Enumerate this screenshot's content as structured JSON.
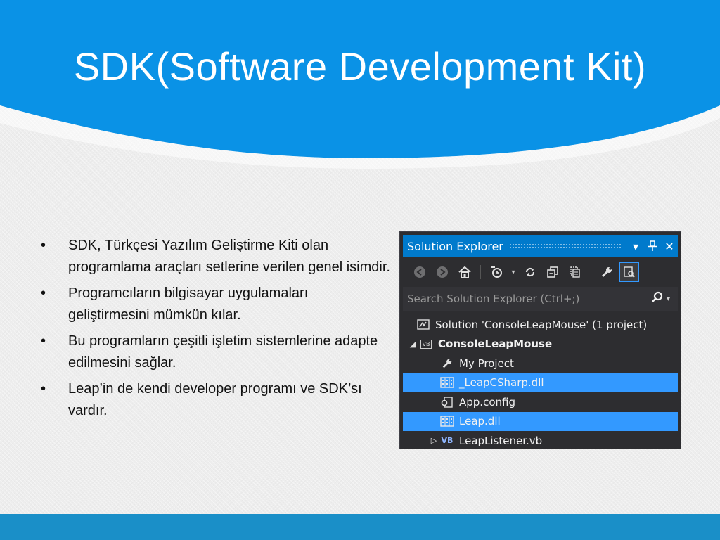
{
  "slide": {
    "title": "SDK(Software Development Kit)",
    "colors": {
      "header": "#0a92e6",
      "bottom_bar": "#1a8fc8",
      "background": "#ededed"
    }
  },
  "bullets": [
    "SDK, Türkçesi Yazılım Geliştirme Kiti olan programlama araçları setlerine verilen genel isimdir.",
    "Programcıların bilgisayar uygulamaları geliştirmesini mümkün kılar.",
    "Bu programların çeşitli işletim sistemlerine adapte edilmesini sağlar.",
    "Leap’in de kendi developer programı ve SDK’sı vardır."
  ],
  "solution_explorer": {
    "title": "Solution Explorer",
    "title_icons": [
      "dropdown-icon",
      "pin-icon",
      "close-icon"
    ],
    "toolbar_icons": [
      "back-icon",
      "forward-icon",
      "home-icon",
      "pending-changes-icon",
      "refresh-icon",
      "collapse-all-icon",
      "show-all-files-icon",
      "properties-icon",
      "preview-icon"
    ],
    "search_placeholder": "Search Solution Explorer (Ctrl+;)",
    "tree": [
      {
        "label": "Solution 'ConsoleLeapMouse' (1 project)",
        "icon": "solution-icon",
        "level": 0,
        "expander": "",
        "selected": false,
        "bold": false
      },
      {
        "label": "ConsoleLeapMouse",
        "icon": "vb-project-icon",
        "level": 0,
        "expander": "◢",
        "selected": false,
        "bold": true
      },
      {
        "label": "My Project",
        "icon": "wrench-icon",
        "level": 1,
        "expander": "",
        "selected": false,
        "bold": false
      },
      {
        "label": "_LeapCSharp.dll",
        "icon": "dll-icon",
        "level": 1,
        "expander": "",
        "selected": true,
        "bold": false
      },
      {
        "label": "App.config",
        "icon": "config-icon",
        "level": 1,
        "expander": "",
        "selected": false,
        "bold": false
      },
      {
        "label": "Leap.dll",
        "icon": "dll-icon",
        "level": 1,
        "expander": "",
        "selected": true,
        "bold": false
      },
      {
        "label": "LeapListener.vb",
        "icon": "vb-file-icon",
        "level": 1,
        "expander": "▷",
        "selected": false,
        "bold": false
      }
    ]
  }
}
